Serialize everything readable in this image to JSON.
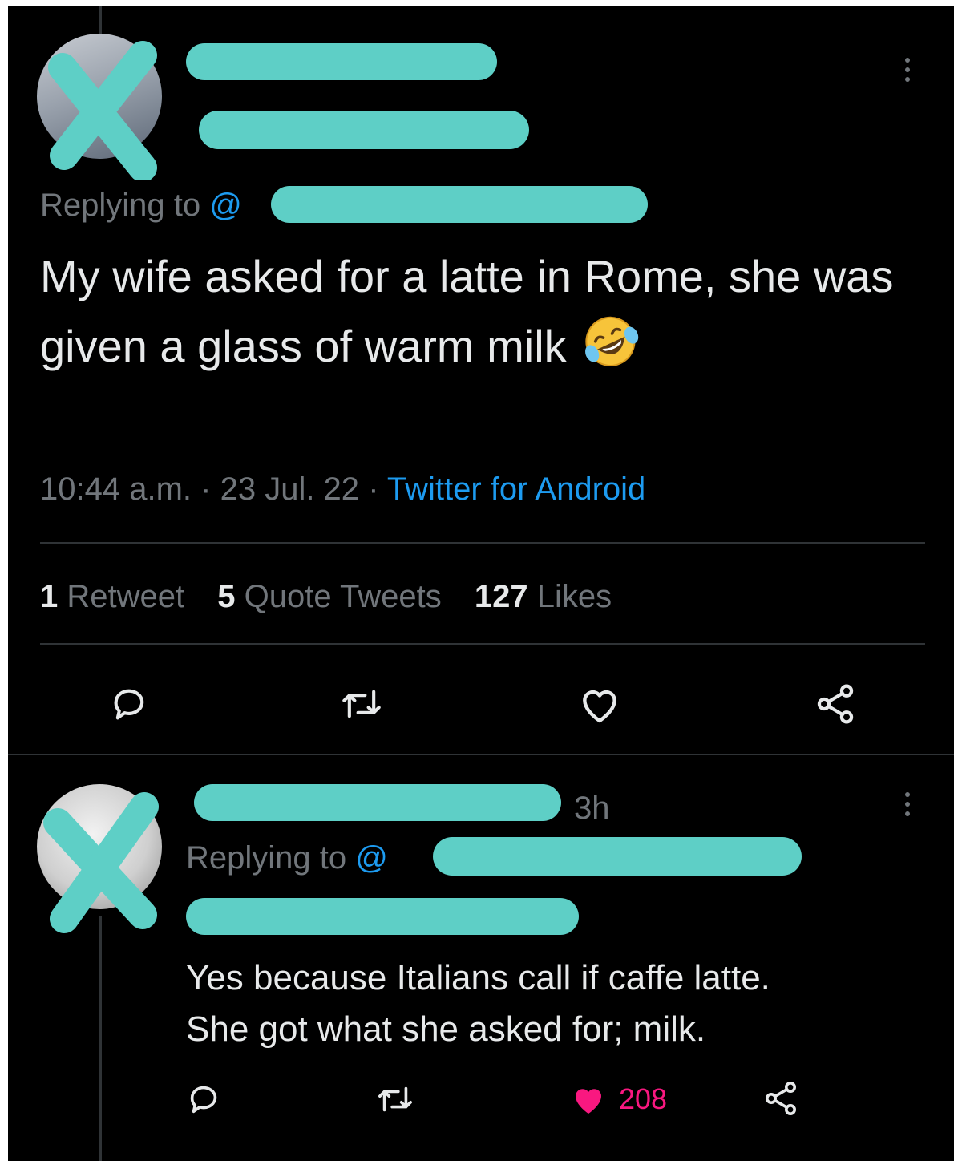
{
  "tweet": {
    "replying_to_label": "Replying to",
    "replying_to_handle": "@",
    "text": "My wife asked for a latte in Rome, she was given a glass of warm milk",
    "emoji": "rolling-on-the-floor-laughing",
    "time": "10:44 a.m.",
    "date": "23 Jul. 22",
    "separator": "·",
    "source": "Twitter for Android",
    "stats": {
      "retweets_count": "1",
      "retweets_label": "Retweet",
      "quotes_count": "5",
      "quotes_label": "Quote Tweets",
      "likes_count": "127",
      "likes_label": "Likes"
    },
    "actions": [
      "reply-icon",
      "retweet-icon",
      "like-icon",
      "share-icon"
    ]
  },
  "reply": {
    "time_ago": "3h",
    "replying_to_label": "Replying to",
    "replying_to_handle": "@",
    "text_line1": "Yes because Italians call if caffe latte.",
    "text_line2": "She got what she asked for; milk.",
    "like_count": "208",
    "liked": true
  },
  "colors": {
    "background": "#000000",
    "text": "#e7e9ea",
    "secondary": "#71767b",
    "link": "#1d9bf0",
    "like": "#f91880",
    "redaction": "#5ecfc6"
  }
}
